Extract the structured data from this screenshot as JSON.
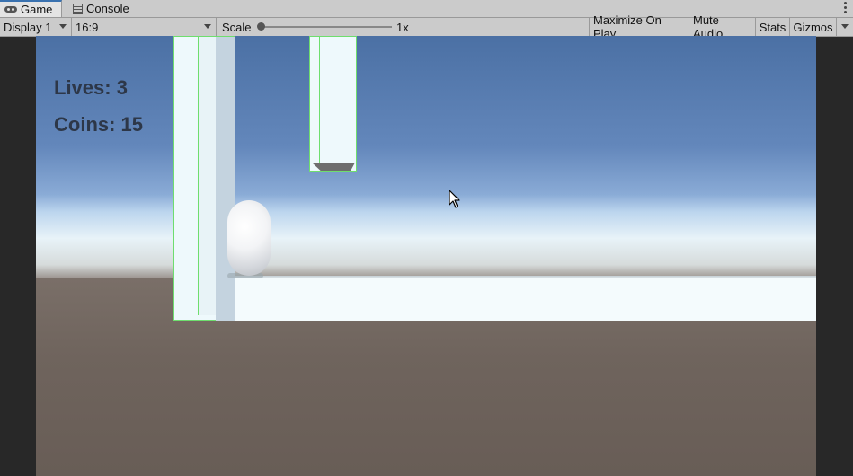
{
  "tabs": [
    {
      "label": "Game",
      "icon": "gamepad-icon",
      "active": true
    },
    {
      "label": "Console",
      "icon": "console-icon",
      "active": false
    }
  ],
  "toolbar": {
    "display": "Display 1",
    "aspect": "16:9",
    "scale_label": "Scale",
    "scale_value": "1x",
    "maximize_on_play": "Maximize On Play",
    "mute_audio": "Mute Audio",
    "stats": "Stats",
    "gizmos": "Gizmos"
  },
  "hud": {
    "lives": "Lives: 3",
    "coins": "Coins: 15"
  },
  "colors": {
    "hud_text": "#2d3748",
    "gizmo_outline": "#6ede6e",
    "tab_active_accent": "#3a72b0"
  }
}
